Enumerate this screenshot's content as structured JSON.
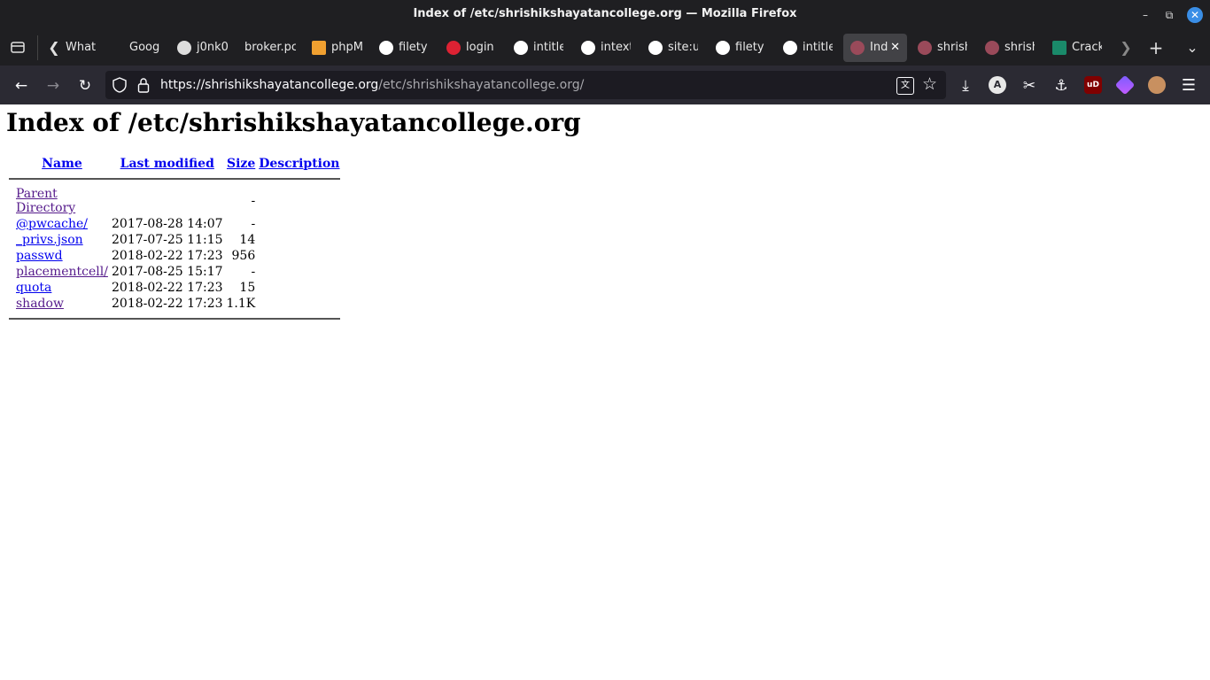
{
  "window": {
    "title": "Index of /etc/shrishikshayatancollege.org — Mozilla Firefox"
  },
  "tabs": [
    {
      "label": "What"
    },
    {
      "label": "Goog"
    },
    {
      "label": "j0nk0"
    },
    {
      "label": "broker.pc"
    },
    {
      "label": "phpM"
    },
    {
      "label": "filety"
    },
    {
      "label": "login"
    },
    {
      "label": "intitle"
    },
    {
      "label": "intext"
    },
    {
      "label": "site:u"
    },
    {
      "label": "filety"
    },
    {
      "label": "intitle"
    },
    {
      "label": "Ind"
    },
    {
      "label": "shrish"
    },
    {
      "label": "shrish"
    },
    {
      "label": "Crack"
    }
  ],
  "navbar": {
    "url_host": "https://shrishikshayatancollege.org",
    "url_path": "/etc/shrishikshayatancollege.org/",
    "extension_badge": "A",
    "ublock_badge": "uD"
  },
  "page": {
    "heading": "Index of /etc/shrishikshayatancollege.org",
    "columns": {
      "name": "Name",
      "last_modified": "Last modified",
      "size": "Size",
      "description": "Description"
    },
    "rows": [
      {
        "name": "Parent Directory",
        "modified": "",
        "size": "-",
        "description": ""
      },
      {
        "name": "@pwcache/",
        "modified": "2017-08-28 14:07",
        "size": "-",
        "description": ""
      },
      {
        "name": "_privs.json",
        "modified": "2017-07-25 11:15",
        "size": "14",
        "description": ""
      },
      {
        "name": "passwd",
        "modified": "2018-02-22 17:23",
        "size": "956",
        "description": ""
      },
      {
        "name": "placementcell/",
        "modified": "2017-08-25 15:17",
        "size": "-",
        "description": ""
      },
      {
        "name": "quota",
        "modified": "2018-02-22 17:23",
        "size": "15",
        "description": ""
      },
      {
        "name": "shadow",
        "modified": "2018-02-22 17:23",
        "size": "1.1K",
        "description": ""
      }
    ]
  }
}
